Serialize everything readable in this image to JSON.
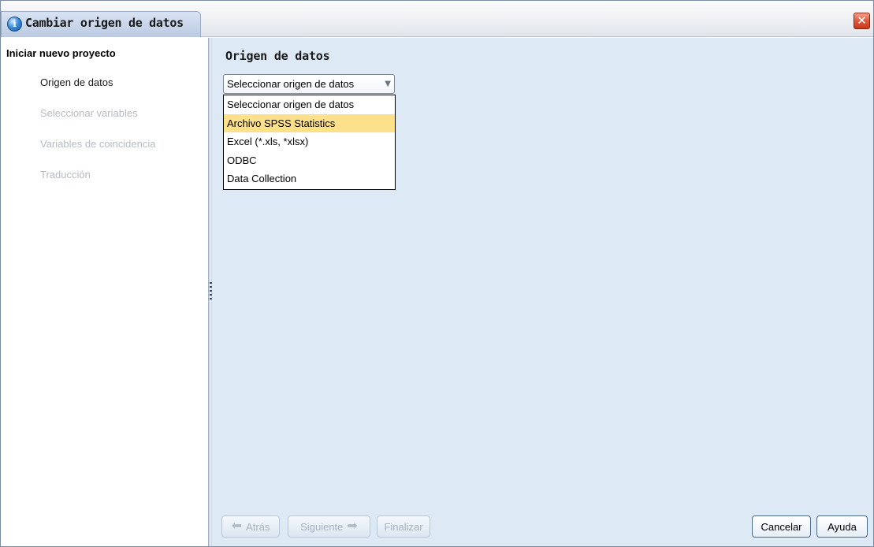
{
  "window": {
    "title": "Cambiar origen de datos",
    "close_glyph": "✕",
    "app_icon_glyph": "i"
  },
  "sidebar": {
    "header": "Iniciar nuevo proyecto",
    "items": [
      {
        "label": "Origen de datos",
        "state": "active"
      },
      {
        "label": "Seleccionar variables",
        "state": "disabled"
      },
      {
        "label": "Variables de coincidencia",
        "state": "disabled"
      },
      {
        "label": "Traducción",
        "state": "disabled"
      }
    ]
  },
  "main": {
    "section_title": "Origen de datos",
    "combo": {
      "selected": "Seleccionar origen de datos",
      "arrow_icon": "chevron-down-icon"
    },
    "dropdown_options": [
      "Seleccionar origen de datos",
      "Archivo SPSS Statistics",
      "Excel (*.xls, *xlsx)",
      "ODBC",
      "Data Collection"
    ],
    "highlighted_option": "Archivo SPSS Statistics"
  },
  "footer": {
    "back_label": "Atrás",
    "next_label": "Siguiente",
    "finish_label": "Finalizar",
    "cancel_label": "Cancelar",
    "help_label": "Ayuda"
  },
  "colors": {
    "content_bg": "#ddeaf6",
    "highlight": "#fde18a",
    "disabled_text": "#b7bcc3"
  }
}
